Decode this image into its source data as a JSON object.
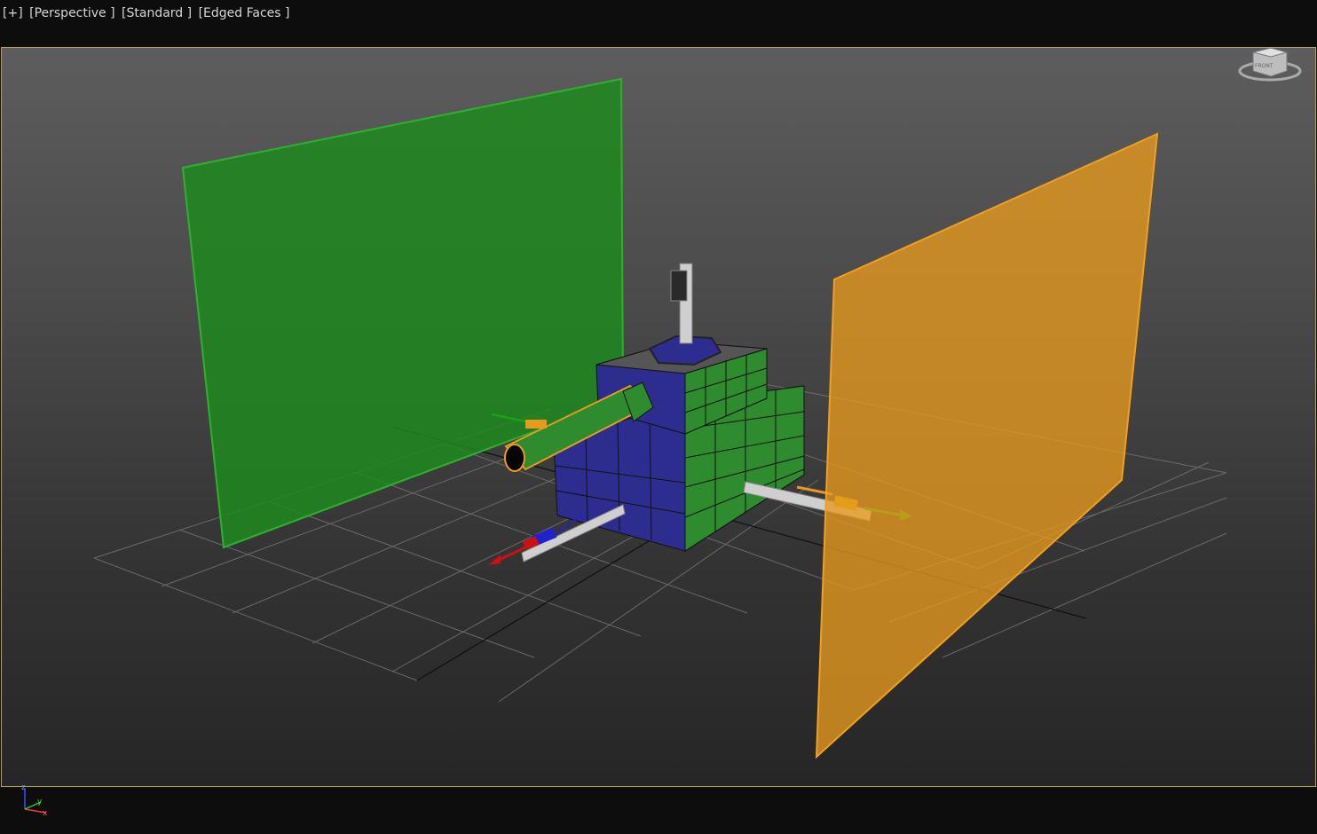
{
  "viewport": {
    "label_plus": "[+]",
    "label_view": "[Perspective ]",
    "label_shading": "[Standard ]",
    "label_display": "[Edged Faces ]"
  },
  "viewcube": {
    "face_label": "FRONT",
    "icon": "viewcube-icon"
  },
  "axis_tripod": {
    "x": "x",
    "y": "y",
    "z": "z"
  },
  "colors": {
    "viewport_border": "#b8a62a",
    "green_plane": "#1f8a1f",
    "orange_plane": "#e89a1e",
    "cube_green": "#2e8b2e",
    "cube_blue": "#2d2d8f",
    "gizmo_red": "#cc1111",
    "gizmo_green": "#11aa11",
    "gizmo_blue": "#1111cc"
  }
}
